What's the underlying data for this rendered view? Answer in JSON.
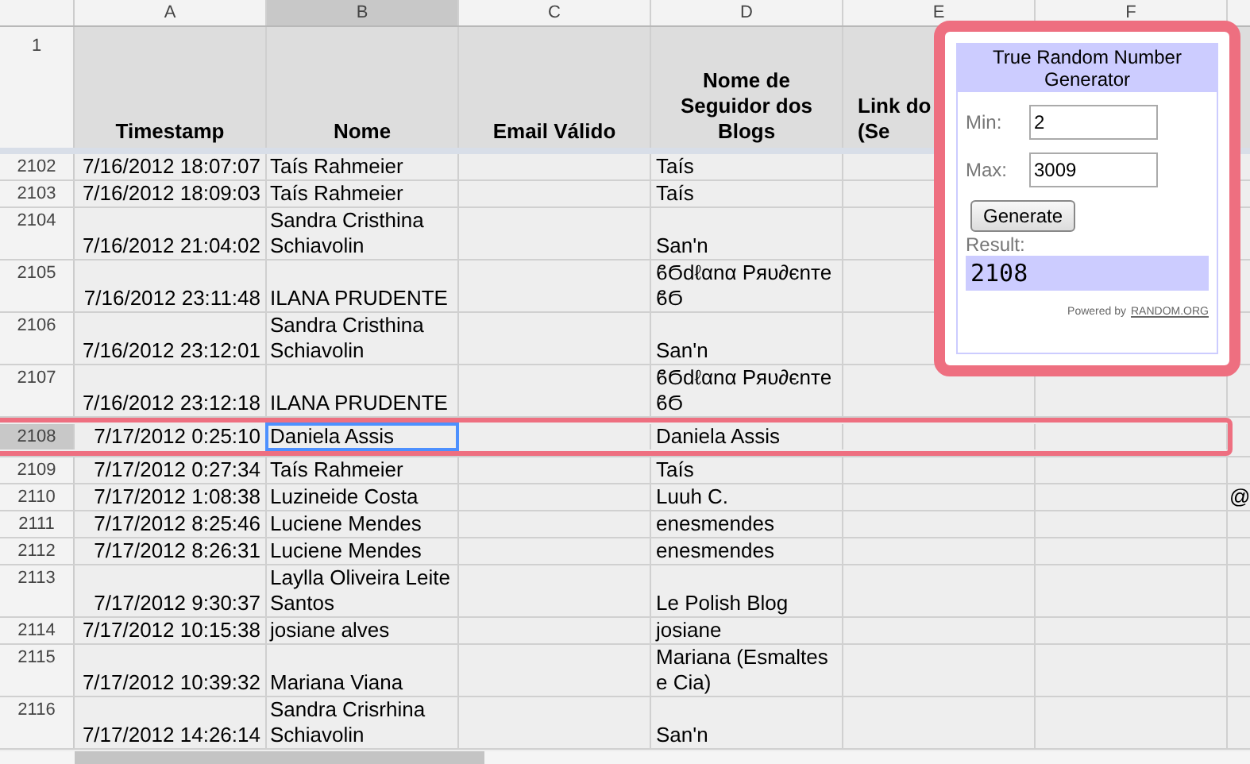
{
  "columns": [
    {
      "letter": "A",
      "selected": false
    },
    {
      "letter": "B",
      "selected": true
    },
    {
      "letter": "C",
      "selected": false
    },
    {
      "letter": "D",
      "selected": false
    },
    {
      "letter": "E",
      "selected": false
    },
    {
      "letter": "F",
      "selected": false
    }
  ],
  "header_row": {
    "number": "1",
    "cells": [
      "Timestamp",
      "Nome",
      "Email Válido",
      "Nome de Seguidor dos Blogs",
      "Link do\n(Se"
    ]
  },
  "rows": [
    {
      "number": "2102",
      "selected": false,
      "timestamp": "7/16/2012 18:07:07",
      "nome": "Taís Rahmeier",
      "seguidor": "Taís"
    },
    {
      "number": "2103",
      "selected": false,
      "timestamp": "7/16/2012 18:09:03",
      "nome": "Taís Rahmeier",
      "seguidor": "Taís"
    },
    {
      "number": "2104",
      "selected": false,
      "timestamp": "7/16/2012 21:04:02",
      "nome": "Sandra Cristhina Schiavolin",
      "seguidor": "San'n"
    },
    {
      "number": "2105",
      "selected": false,
      "timestamp": "7/16/2012 23:11:48",
      "nome": "ILANA PRUDENTE",
      "seguidor": "ϐϬdℓαnα Pяυ∂єnтe ϐϬ"
    },
    {
      "number": "2106",
      "selected": false,
      "timestamp": "7/16/2012 23:12:01",
      "nome": "Sandra Cristhina Schiavolin",
      "seguidor": "San'n"
    },
    {
      "number": "2107",
      "selected": false,
      "timestamp": "7/16/2012 23:12:18",
      "nome": "ILANA PRUDENTE",
      "seguidor": "ϐϬdℓαnα Pяυ∂єnтe ϐϬ"
    },
    {
      "number": "2108",
      "selected": true,
      "timestamp": "7/17/2012 0:25:10",
      "nome": "Daniela Assis",
      "seguidor": "Daniela Assis"
    },
    {
      "number": "2109",
      "selected": false,
      "timestamp": "7/17/2012 0:27:34",
      "nome": "Taís Rahmeier",
      "seguidor": "Taís"
    },
    {
      "number": "2110",
      "selected": false,
      "timestamp": "7/17/2012 1:08:38",
      "nome": "Luzineide Costa",
      "seguidor": "Luuh C.",
      "column_7": "@"
    },
    {
      "number": "2111",
      "selected": false,
      "timestamp": "7/17/2012 8:25:46",
      "nome": "Luciene Mendes",
      "seguidor": "enesmendes"
    },
    {
      "number": "2112",
      "selected": false,
      "timestamp": "7/17/2012 8:26:31",
      "nome": "Luciene Mendes",
      "seguidor": "enesmendes"
    },
    {
      "number": "2113",
      "selected": false,
      "timestamp": "7/17/2012 9:30:37",
      "nome": "Laylla Oliveira Leite Santos",
      "seguidor": "Le Polish Blog"
    },
    {
      "number": "2114",
      "selected": false,
      "timestamp": "7/17/2012 10:15:38",
      "nome": "josiane alves",
      "seguidor": "josiane"
    },
    {
      "number": "2115",
      "selected": false,
      "timestamp": "7/17/2012 10:39:32",
      "nome": "Mariana Viana",
      "seguidor": "Mariana (Esmaltes e Cia)"
    },
    {
      "number": "2116",
      "selected": false,
      "timestamp": "7/17/2012 14:26:14",
      "nome": "Sandra Crisrhina Schiavolin",
      "seguidor": "San'n"
    }
  ],
  "generator": {
    "title": "True Random Number Generator",
    "min_label": "Min:",
    "min_value": "2",
    "max_label": "Max:",
    "max_value": "3009",
    "button": "Generate",
    "result_label": "Result:",
    "result": "2108",
    "powered_by": "Powered by",
    "powered_link": "RANDOM.ORG"
  }
}
